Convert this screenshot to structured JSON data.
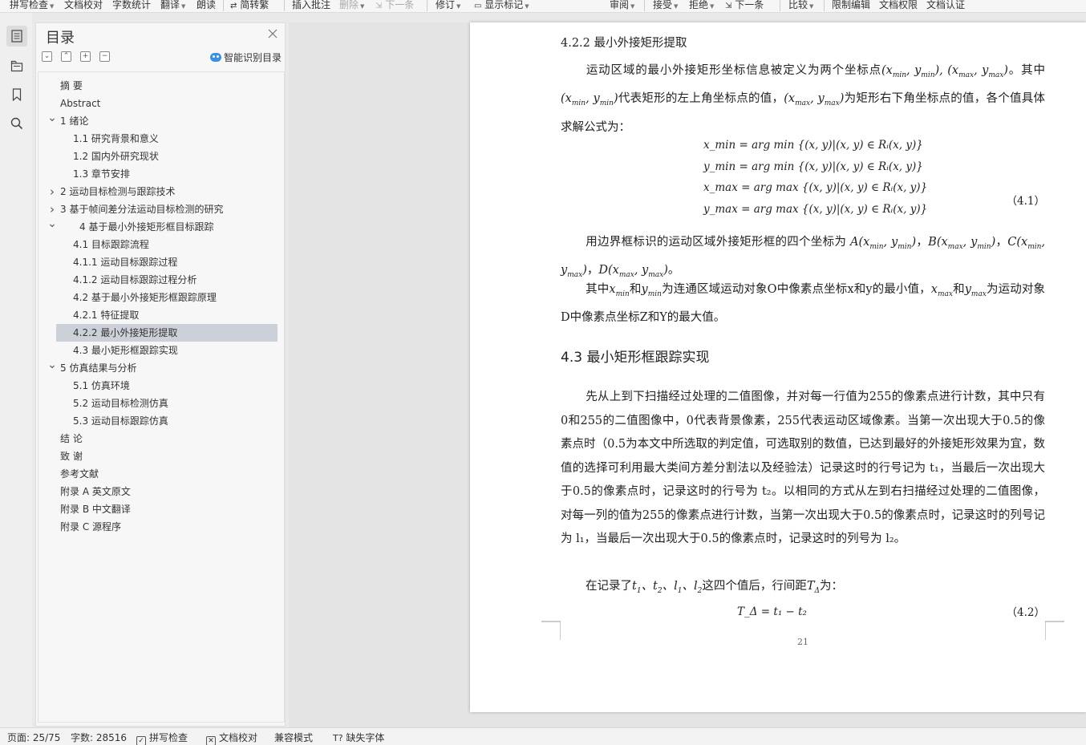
{
  "toolbar": {
    "items": [
      {
        "label": "拼写检查",
        "caret": true,
        "enabled": true
      },
      {
        "label": "文档校对",
        "caret": false,
        "enabled": true
      },
      {
        "label": "字数统计",
        "caret": false,
        "enabled": true
      },
      {
        "label": "翻译",
        "caret": true,
        "enabled": true
      },
      {
        "label": "朗读",
        "caret": false,
        "enabled": true
      },
      {
        "label": "简转繁",
        "caret": false,
        "enabled": true
      },
      {
        "label": "插入批注",
        "caret": false,
        "enabled": true
      },
      {
        "label": "删除",
        "caret": true,
        "enabled": false
      },
      {
        "label": "下一条",
        "caret": false,
        "enabled": false
      },
      {
        "label": "修订",
        "caret": true,
        "enabled": true
      },
      {
        "label": "显示标记",
        "caret": true,
        "enabled": true
      },
      {
        "label": "审阅",
        "caret": true,
        "enabled": true
      },
      {
        "label": "接受",
        "caret": true,
        "enabled": true
      },
      {
        "label": "拒绝",
        "caret": true,
        "enabled": true
      },
      {
        "label": "下一条",
        "caret": false,
        "enabled": true
      },
      {
        "label": "比较",
        "caret": true,
        "enabled": true
      },
      {
        "label": "限制编辑",
        "caret": false,
        "enabled": true
      },
      {
        "label": "文档权限",
        "caret": false,
        "enabled": true
      },
      {
        "label": "文档认证",
        "caret": false,
        "enabled": true
      }
    ]
  },
  "toc": {
    "title": "目录",
    "smart_label": "智能识别目录",
    "items": [
      {
        "label": "摘  要",
        "level": 0,
        "arrow": ""
      },
      {
        "label": "Abstract",
        "level": 0,
        "arrow": ""
      },
      {
        "label": "1    绪论",
        "level": 0,
        "arrow": "down"
      },
      {
        "label": "1.1    研究背景和意义",
        "level": 1,
        "arrow": ""
      },
      {
        "label": "1.2    国内外研究现状",
        "level": 1,
        "arrow": ""
      },
      {
        "label": "1.3    章节安排",
        "level": 1,
        "arrow": ""
      },
      {
        "label": "2    运动目标检测与跟踪技术",
        "level": 0,
        "arrow": "right"
      },
      {
        "label": "3    基于帧间差分法运动目标检测的研究",
        "level": 0,
        "arrow": "right"
      },
      {
        "label": "4    基于最小外接矩形框目标跟踪",
        "level": 0,
        "arrow": "down",
        "extra_indent": true
      },
      {
        "label": "4.1    目标跟踪流程",
        "level": 1,
        "arrow": ""
      },
      {
        "label": "4.1.1    运动目标跟踪过程",
        "level": 1,
        "arrow": ""
      },
      {
        "label": "4.1.2    运动目标跟踪过程分析",
        "level": 1,
        "arrow": ""
      },
      {
        "label": "4.2    基于最小外接矩形框跟踪原理",
        "level": 1,
        "arrow": ""
      },
      {
        "label": "4.2.1    特征提取",
        "level": 1,
        "arrow": ""
      },
      {
        "label": "4.2.2    最小外接矩形提取",
        "level": 1,
        "arrow": "",
        "selected": true
      },
      {
        "label": "4.3    最小矩形框跟踪实现",
        "level": 1,
        "arrow": ""
      },
      {
        "label": "5    仿真结果与分析",
        "level": 0,
        "arrow": "down"
      },
      {
        "label": "5.1    仿真环境",
        "level": 1,
        "arrow": ""
      },
      {
        "label": "5.2    运动目标检测仿真",
        "level": 1,
        "arrow": ""
      },
      {
        "label": "5.3    运动目标跟踪仿真",
        "level": 1,
        "arrow": ""
      },
      {
        "label": "结  论",
        "level": 0,
        "arrow": ""
      },
      {
        "label": "致  谢",
        "level": 0,
        "arrow": ""
      },
      {
        "label": "参考文献",
        "level": 0,
        "arrow": ""
      },
      {
        "label": "附录 A    英文原文",
        "level": 0,
        "arrow": ""
      },
      {
        "label": "附录 B    中文翻译",
        "level": 0,
        "arrow": ""
      },
      {
        "label": "附录 C    源程序",
        "level": 0,
        "arrow": ""
      }
    ]
  },
  "doc": {
    "h_422": "4.2.2    最小外接矩形提取",
    "p1_a": "运动区域的最小外接矩形坐标信息被定义为两个坐标点",
    "p1_b": "。其中",
    "p1_c": "代表矩形的左上角坐标点的值，",
    "p1_d": "为矩形右下角坐标点的值，各个值具体求解公式为：",
    "formula_lines": [
      "x_min = arg min {(x, y)|(x, y) ∈ Rᵢ(x, y)}",
      "y_min = arg min {(x, y)|(x, y) ∈ Rᵢ(x, y)}",
      "x_max = arg max {(x, y)|(x, y) ∈ Rᵢ(x, y)}",
      "y_max = arg max {(x, y)|(x, y) ∈ Rᵢ(x, y)}"
    ],
    "eq1": "（4.1）",
    "p2": "用边界框标识的运动区域外接矩形框的四个坐标为",
    "p3_a": "其中",
    "p3_and1": "和",
    "p3_b": "为连通区域运动对象O中像素点坐标x和y的最小值，",
    "p3_and2": "和",
    "p3_c": "为运动对象D中像素点坐标Z和Y的最大值。",
    "h_43": "4.3    最小矩形框跟踪实现",
    "p4": "先从上到下扫描经过处理的二值图像，并对每一行值为255的像素点进行计数，其中只有0和255的二值图像中，0代表背景像素，255代表运动区域像素。当第一次出现大于0.5的像素点时（0.5为本文中所选取的判定值，可选取别的数值，已达到最好的外接矩形效果为宜，数值的选择可利用最大类间方差分割法以及经验法）记录这时的行号记为 t₁，当最后一次出现大于0.5的像素点时，记录这时的行号为 t₂。以相同的方式从左到右扫描经过处理的二值图像，对每一列的值为255的像素点进行计数，当第一次出现大于0.5的像素点时，记录这时的列号记为 l₁，当最后一次出现大于0.5的像素点时，记录这时的列号为 l₂。",
    "p5_a": "在记录了",
    "p5_b": "这四个值后，行间距",
    "p5_c": "为：",
    "formula2": "T_Δ = t₁ − t₂",
    "eq2": "（4.2）",
    "page_number": "21"
  },
  "status": {
    "page": "页面: 25/75",
    "words": "字数: 28516",
    "spell": "拼写检查",
    "proof": "文档校对",
    "compat": "兼容模式",
    "missing_font": "缺失字体"
  }
}
